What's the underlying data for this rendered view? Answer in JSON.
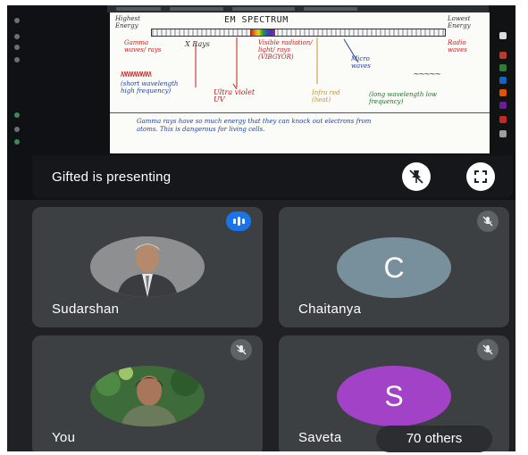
{
  "presenting_bar": {
    "text": "Gifted is presenting",
    "pin_button_icon": "pin-off-icon",
    "fullscreen_button_icon": "fullscreen-icon"
  },
  "slide": {
    "title": "EM SPECTRUM",
    "highest_energy": "Highest Energy",
    "lowest_energy": "Lowest Energy",
    "gamma": "Gamma waves/ rays",
    "xrays": "X Rays",
    "visible": "Visible radiation/ light/ rays (VIBGYOR)",
    "micro": "Micro waves",
    "radio": "Radio waves",
    "short_wave": "(short wavelength high frequency)",
    "ultraviolet": "Ultra violet UV",
    "infrared": "Infra red (heat)",
    "long_wave": "(long wavelength low frequency)",
    "note": "Gamma rays have so much energy that they can knock out electrons from atoms. This is dangerous for living cells."
  },
  "participants": [
    {
      "name": "Sudarshan",
      "avatar_type": "photo",
      "status": "speaking"
    },
    {
      "name": "Chaitanya",
      "avatar_letter": "C",
      "avatar_color": "#78909c",
      "status": "muted"
    },
    {
      "name": "You",
      "avatar_type": "photo",
      "status": "muted"
    },
    {
      "name": "Saveta",
      "avatar_letter": "S",
      "avatar_color": "#a142c7",
      "status": "muted"
    }
  ],
  "others_label": "70 others",
  "colors": {
    "background": "#202124",
    "tile": "#3c4043",
    "speaking_accent": "#1a73e8"
  }
}
